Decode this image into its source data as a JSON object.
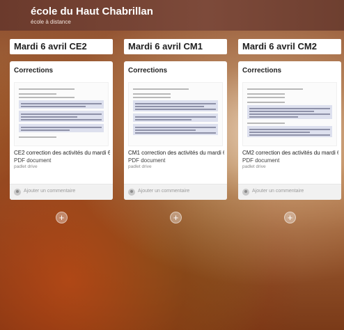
{
  "header": {
    "title": "école du Haut Chabrillan",
    "subtitle": "école à distance"
  },
  "columns": [
    {
      "title": "Mardi 6 avril CE2",
      "card": {
        "heading": "Corrections",
        "file_name": "CE2 correction des activités du mardi 6 ...",
        "file_type": "PDF document",
        "file_source": "padlet drive",
        "comment_placeholder": "Ajouter un commentaire"
      }
    },
    {
      "title": "Mardi 6 avril CM1",
      "card": {
        "heading": "Corrections",
        "file_name": "CM1 correction des activités du mardi 6 ...",
        "file_type": "PDF document",
        "file_source": "padlet drive",
        "comment_placeholder": "Ajouter un commentaire"
      }
    },
    {
      "title": "Mardi 6 avril CM2",
      "card": {
        "heading": "Corrections",
        "file_name": "CM2 correction des activités du mardi 6 ...",
        "file_type": "PDF document",
        "file_source": "padlet drive",
        "comment_placeholder": "Ajouter un commentaire"
      }
    }
  ],
  "add_button_symbol": "+",
  "icons": [
    "avatar-icon",
    "add-post-icon",
    "pdf-preview"
  ]
}
